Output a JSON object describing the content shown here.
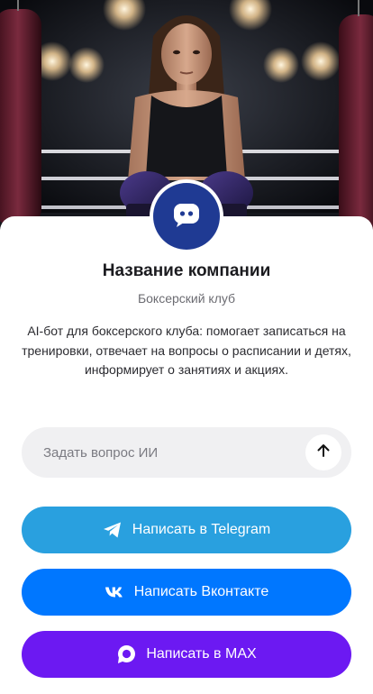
{
  "company": {
    "name": "Название компании",
    "type": "Боксерский клуб",
    "description": "AI-бот для боксерского клуба: помогает записаться на тренировки, отвечает на вопросы о расписании и детях, информирует о занятиях и акциях."
  },
  "ask": {
    "placeholder": "Задать вопрос ИИ",
    "value": ""
  },
  "buttons": {
    "telegram": "Написать в Telegram",
    "vk": "Написать Вконтакте",
    "max": "Написать в MAX"
  },
  "colors": {
    "avatar": "#1f3a93",
    "telegram": "#29a0df",
    "vk": "#0077ff",
    "max": "#6c19f2",
    "ask_background": "#f0f0f2"
  },
  "icons": {
    "avatar": "chat-bot-icon",
    "send": "arrow-up-icon",
    "telegram": "telegram-icon",
    "vk": "vk-icon",
    "max": "max-icon"
  }
}
